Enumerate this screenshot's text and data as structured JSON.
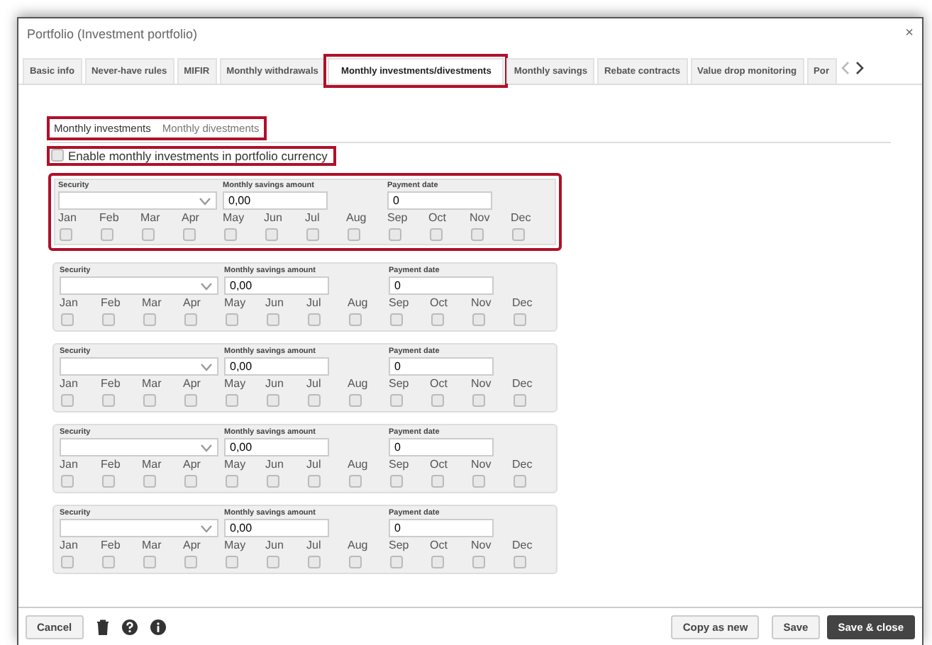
{
  "window": {
    "title": "Portfolio (Investment portfolio)",
    "close": "×"
  },
  "tabs": [
    {
      "label": "Basic info",
      "selected": false,
      "highlighted": false
    },
    {
      "label": "Never-have rules",
      "selected": false,
      "highlighted": false
    },
    {
      "label": "MIFIR",
      "selected": false,
      "highlighted": false
    },
    {
      "label": "Monthly withdrawals",
      "selected": false,
      "highlighted": false
    },
    {
      "label": "Monthly investments/divestments",
      "selected": true,
      "highlighted": true
    },
    {
      "label": "Monthly savings",
      "selected": false,
      "highlighted": false
    },
    {
      "label": "Rebate contracts",
      "selected": false,
      "highlighted": false
    },
    {
      "label": "Value drop monitoring",
      "selected": false,
      "highlighted": false
    },
    {
      "label": "Por",
      "selected": false,
      "highlighted": false
    }
  ],
  "subtabs": {
    "highlighted": true,
    "items": [
      {
        "label": "Monthly investments",
        "selected": true
      },
      {
        "label": "Monthly divestments",
        "selected": false
      }
    ]
  },
  "currency_option": {
    "label": "Enable monthly investments in portfolio currency",
    "checked": false,
    "highlighted": true
  },
  "entries": [
    {
      "highlighted": true,
      "security_label": "Security",
      "amount_label": "Monthly savings amount",
      "amount": "0,00",
      "date_label": "Payment date",
      "date": "0",
      "months": [
        {
          "label": "Jan",
          "checked": false
        },
        {
          "label": "Feb",
          "checked": false
        },
        {
          "label": "Mar",
          "checked": false
        },
        {
          "label": "Apr",
          "checked": false
        },
        {
          "label": "May",
          "checked": false
        },
        {
          "label": "Jun",
          "checked": false
        },
        {
          "label": "Jul",
          "checked": false
        },
        {
          "label": "Aug",
          "checked": false
        },
        {
          "label": "Sep",
          "checked": false
        },
        {
          "label": "Oct",
          "checked": false
        },
        {
          "label": "Nov",
          "checked": false
        },
        {
          "label": "Dec",
          "checked": false
        }
      ]
    },
    {
      "highlighted": false,
      "security_label": "Security",
      "amount_label": "Monthly savings amount",
      "amount": "0,00",
      "date_label": "Payment date",
      "date": "0",
      "months": [
        {
          "label": "Jan",
          "checked": false
        },
        {
          "label": "Feb",
          "checked": false
        },
        {
          "label": "Mar",
          "checked": false
        },
        {
          "label": "Apr",
          "checked": false
        },
        {
          "label": "May",
          "checked": false
        },
        {
          "label": "Jun",
          "checked": false
        },
        {
          "label": "Jul",
          "checked": false
        },
        {
          "label": "Aug",
          "checked": false
        },
        {
          "label": "Sep",
          "checked": false
        },
        {
          "label": "Oct",
          "checked": false
        },
        {
          "label": "Nov",
          "checked": false
        },
        {
          "label": "Dec",
          "checked": false
        }
      ]
    },
    {
      "highlighted": false,
      "security_label": "Security",
      "amount_label": "Monthly savings amount",
      "amount": "0,00",
      "date_label": "Payment date",
      "date": "0",
      "months": [
        {
          "label": "Jan",
          "checked": false
        },
        {
          "label": "Feb",
          "checked": false
        },
        {
          "label": "Mar",
          "checked": false
        },
        {
          "label": "Apr",
          "checked": false
        },
        {
          "label": "May",
          "checked": false
        },
        {
          "label": "Jun",
          "checked": false
        },
        {
          "label": "Jul",
          "checked": false
        },
        {
          "label": "Aug",
          "checked": false
        },
        {
          "label": "Sep",
          "checked": false
        },
        {
          "label": "Oct",
          "checked": false
        },
        {
          "label": "Nov",
          "checked": false
        },
        {
          "label": "Dec",
          "checked": false
        }
      ]
    },
    {
      "highlighted": false,
      "security_label": "Security",
      "amount_label": "Monthly savings amount",
      "amount": "0,00",
      "date_label": "Payment date",
      "date": "0",
      "months": [
        {
          "label": "Jan",
          "checked": false
        },
        {
          "label": "Feb",
          "checked": false
        },
        {
          "label": "Mar",
          "checked": false
        },
        {
          "label": "Apr",
          "checked": false
        },
        {
          "label": "May",
          "checked": false
        },
        {
          "label": "Jun",
          "checked": false
        },
        {
          "label": "Jul",
          "checked": false
        },
        {
          "label": "Aug",
          "checked": false
        },
        {
          "label": "Sep",
          "checked": false
        },
        {
          "label": "Oct",
          "checked": false
        },
        {
          "label": "Nov",
          "checked": false
        },
        {
          "label": "Dec",
          "checked": false
        }
      ]
    },
    {
      "highlighted": false,
      "security_label": "Security",
      "amount_label": "Monthly savings amount",
      "amount": "0,00",
      "date_label": "Payment date",
      "date": "0",
      "months": [
        {
          "label": "Jan",
          "checked": false
        },
        {
          "label": "Feb",
          "checked": false
        },
        {
          "label": "Mar",
          "checked": false
        },
        {
          "label": "Apr",
          "checked": false
        },
        {
          "label": "May",
          "checked": false
        },
        {
          "label": "Jun",
          "checked": false
        },
        {
          "label": "Jul",
          "checked": false
        },
        {
          "label": "Aug",
          "checked": false
        },
        {
          "label": "Sep",
          "checked": false
        },
        {
          "label": "Oct",
          "checked": false
        },
        {
          "label": "Nov",
          "checked": false
        },
        {
          "label": "Dec",
          "checked": false
        }
      ]
    }
  ],
  "footer": {
    "left_buttons": [
      "Cancel"
    ],
    "right_buttons": [
      {
        "label": "Copy as new",
        "kind": "plain"
      },
      {
        "label": "Save",
        "kind": "plain"
      },
      {
        "label": "Save & close",
        "kind": "primary"
      }
    ]
  }
}
